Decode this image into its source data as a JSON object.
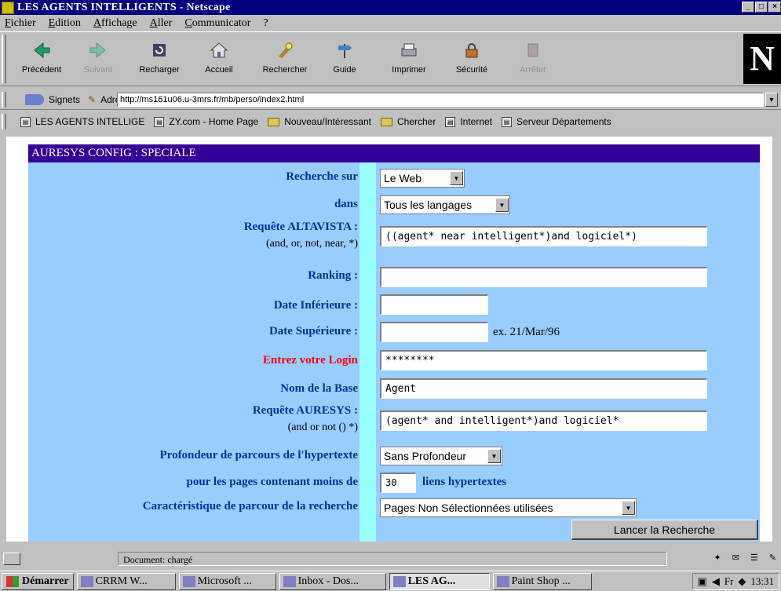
{
  "window": {
    "title": "LES AGENTS INTELLIGENTS - Netscape",
    "controls": [
      "_",
      "□",
      "×"
    ]
  },
  "menu": [
    "Fichier",
    "Edition",
    "Affichage",
    "Aller",
    "Communicator",
    "?"
  ],
  "toolbar": {
    "back": "Précédent",
    "forward": "Suivant",
    "reload": "Recharger",
    "home": "Accueil",
    "search": "Rechercher",
    "guide": "Guide",
    "print": "Imprimer",
    "security": "Sécurité",
    "stop": "Arrêter",
    "logo": "N"
  },
  "location": {
    "bookmarks": "Signets",
    "label": "Adresse:",
    "url": "http://ms161u06.u-3mrs.fr/mb/perso/index2.html"
  },
  "personal": [
    "LES AGENTS INTELLIGE",
    "ZY.com - Home Page",
    "Nouveau/Intéressant",
    "Chercher",
    "Internet",
    "Serveur Départements"
  ],
  "form": {
    "header": "AURESYS CONFIG : SPECIALE",
    "recherche_sur_label": "Recherche sur",
    "recherche_sur_value": "Le Web",
    "dans_label": "dans",
    "dans_value": "Tous les langages",
    "altavista_label": "Requête ALTAVISTA :",
    "altavista_hint": "(and, or, not, near, *)",
    "altavista_value": "((agent* near intelligent*)and logiciel*)",
    "ranking_label": "Ranking :",
    "ranking_value": "",
    "date_inf_label": "Date Inférieure :",
    "date_inf_value": "",
    "date_sup_label": "Date Supérieure :",
    "date_sup_value": "",
    "date_example": "ex. 21/Mar/96",
    "login_label": "Entrez votre Login",
    "login_value": "********",
    "base_label": "Nom de la Base",
    "base_value": "Agent",
    "auresys_label": "Requête AURESYS :",
    "auresys_hint": "(and or not () *)",
    "auresys_value": "(agent* and intelligent*)and logiciel*",
    "profondeur_label": "Profondeur de parcours de l'hypertexte",
    "profondeur_value": "Sans Profondeur",
    "pages_label": "pour les pages contenant moins de",
    "pages_value": "30",
    "pages_unit": "liens hypertextes",
    "carac_label": "Caractéristique de parcour de la recherche",
    "carac_value": "Pages Non Sélectionnées utilisées",
    "submit": "Lancer la Recherche"
  },
  "status": {
    "text": "Document: chargé"
  },
  "taskbar": {
    "start": "Démarrer",
    "tasks": [
      "CRRM W...",
      "Microsoft ...",
      "Inbox - Dos...",
      "LES AG...",
      "Paint Shop ..."
    ],
    "lang": "Fr",
    "clock": "13:31"
  }
}
